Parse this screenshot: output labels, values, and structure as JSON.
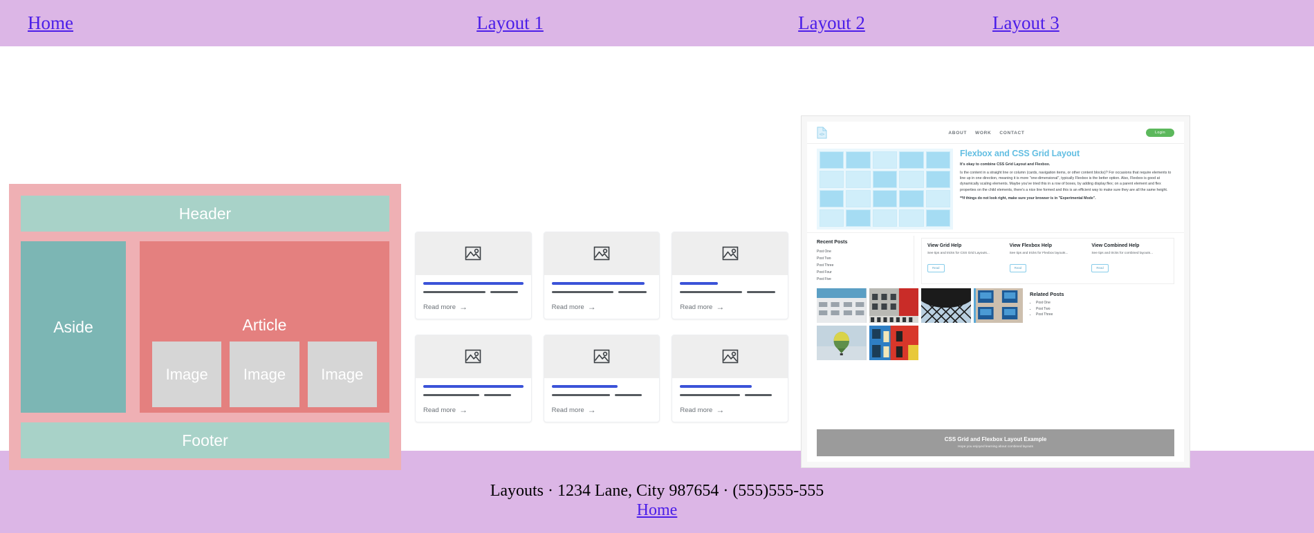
{
  "nav": {
    "items": [
      {
        "label": "Home"
      },
      {
        "label": "Layout 1"
      },
      {
        "label": "Layout 2"
      },
      {
        "label": "Layout 3"
      }
    ]
  },
  "layout1": {
    "header_label": "Header",
    "aside_label": "Aside",
    "article_label": "Article",
    "image_labels": [
      "Image",
      "Image",
      "Image"
    ],
    "footer_label": "Footer",
    "colors": {
      "container": "#efb0b4",
      "header": "#a8d2c8",
      "aside": "#7cb6b4",
      "article": "#e4807f",
      "image": "#d6d6d6",
      "footer": "#a8d2c8"
    }
  },
  "layout2": {
    "accent": "#3b53d8",
    "cards": [
      {
        "read_more": "Read more",
        "arrow": "→",
        "title_width": "100%",
        "line1_width": "62%",
        "line2_width": "28%",
        "icon": "image-placeholder-icon"
      },
      {
        "read_more": "Read more",
        "arrow": "→",
        "title_width": "93%",
        "line1_width": "62%",
        "line2_width": "28%",
        "icon": "image-placeholder-icon"
      },
      {
        "read_more": "Read more",
        "arrow": "→",
        "title_width": "38%",
        "line1_width": "62%",
        "line2_width": "28%",
        "icon": "image-placeholder-icon"
      },
      {
        "read_more": "Read more",
        "arrow": "→",
        "title_width": "100%",
        "line1_width": "56%",
        "line2_width": "27%",
        "icon": "image-placeholder-icon"
      },
      {
        "read_more": "Read more",
        "arrow": "→",
        "title_width": "66%",
        "line1_width": "58%",
        "line2_width": "27%",
        "icon": "image-placeholder-icon"
      },
      {
        "read_more": "Read more",
        "arrow": "→",
        "title_width": "72%",
        "line1_width": "60%",
        "line2_width": "27%",
        "icon": "image-placeholder-icon"
      }
    ]
  },
  "layout3": {
    "logo_icon": "code-file-icon",
    "nav_links": [
      "ABOUT",
      "WORK",
      "CONTACT"
    ],
    "login_label": "Login",
    "hero": {
      "title": "Flexbox and CSS Grid Layout",
      "lead": "It's okay to combine CSS Grid Layout and Flexbox.",
      "body": "Is the content in a straight line or column (cards, navigation items, or other content blocks)? For occasions that require elements to line up in one direction, meaning it is more \"one-dimensional\", typically Flexbox is the better option. Also, Flexbox is good at dynamically scaling elements. Maybe you've tried this in a row of boxes, by adding display:flex; on a parent element and flex properties on the child elements, there's a nice line formed and this is an efficient way to make sure they are all the same height.",
      "note": "**If things do not look right, make sure your browser is in \"Experimental Mode\"."
    },
    "recent_posts": {
      "title": "Recent Posts",
      "items": [
        "Post One",
        "Post Two",
        "Post Three",
        "Post Four",
        "Post Five"
      ]
    },
    "help_cards": [
      {
        "title": "View Grid Help",
        "desc": "See tips and tricks for CSS Grid Layouts...",
        "button": "Read"
      },
      {
        "title": "View Flexbox Help",
        "desc": "See tips and tricks for Flexbox layouts...",
        "button": "Read"
      },
      {
        "title": "View Combined Help",
        "desc": "See tips and tricks for combined layouts...",
        "button": "Read"
      }
    ],
    "related_posts": {
      "title": "Related Posts",
      "items": [
        "Post One",
        "Post Two",
        "Post Three"
      ]
    },
    "footer": {
      "title": "CSS Grid and Flexbox Layout Example",
      "subtitle": "Hope you enjoyed learning about combined layouts"
    }
  },
  "footer": {
    "info": "Layouts · 1234 Lane, City 987654 · (555)555-555",
    "home_link": "Home"
  }
}
